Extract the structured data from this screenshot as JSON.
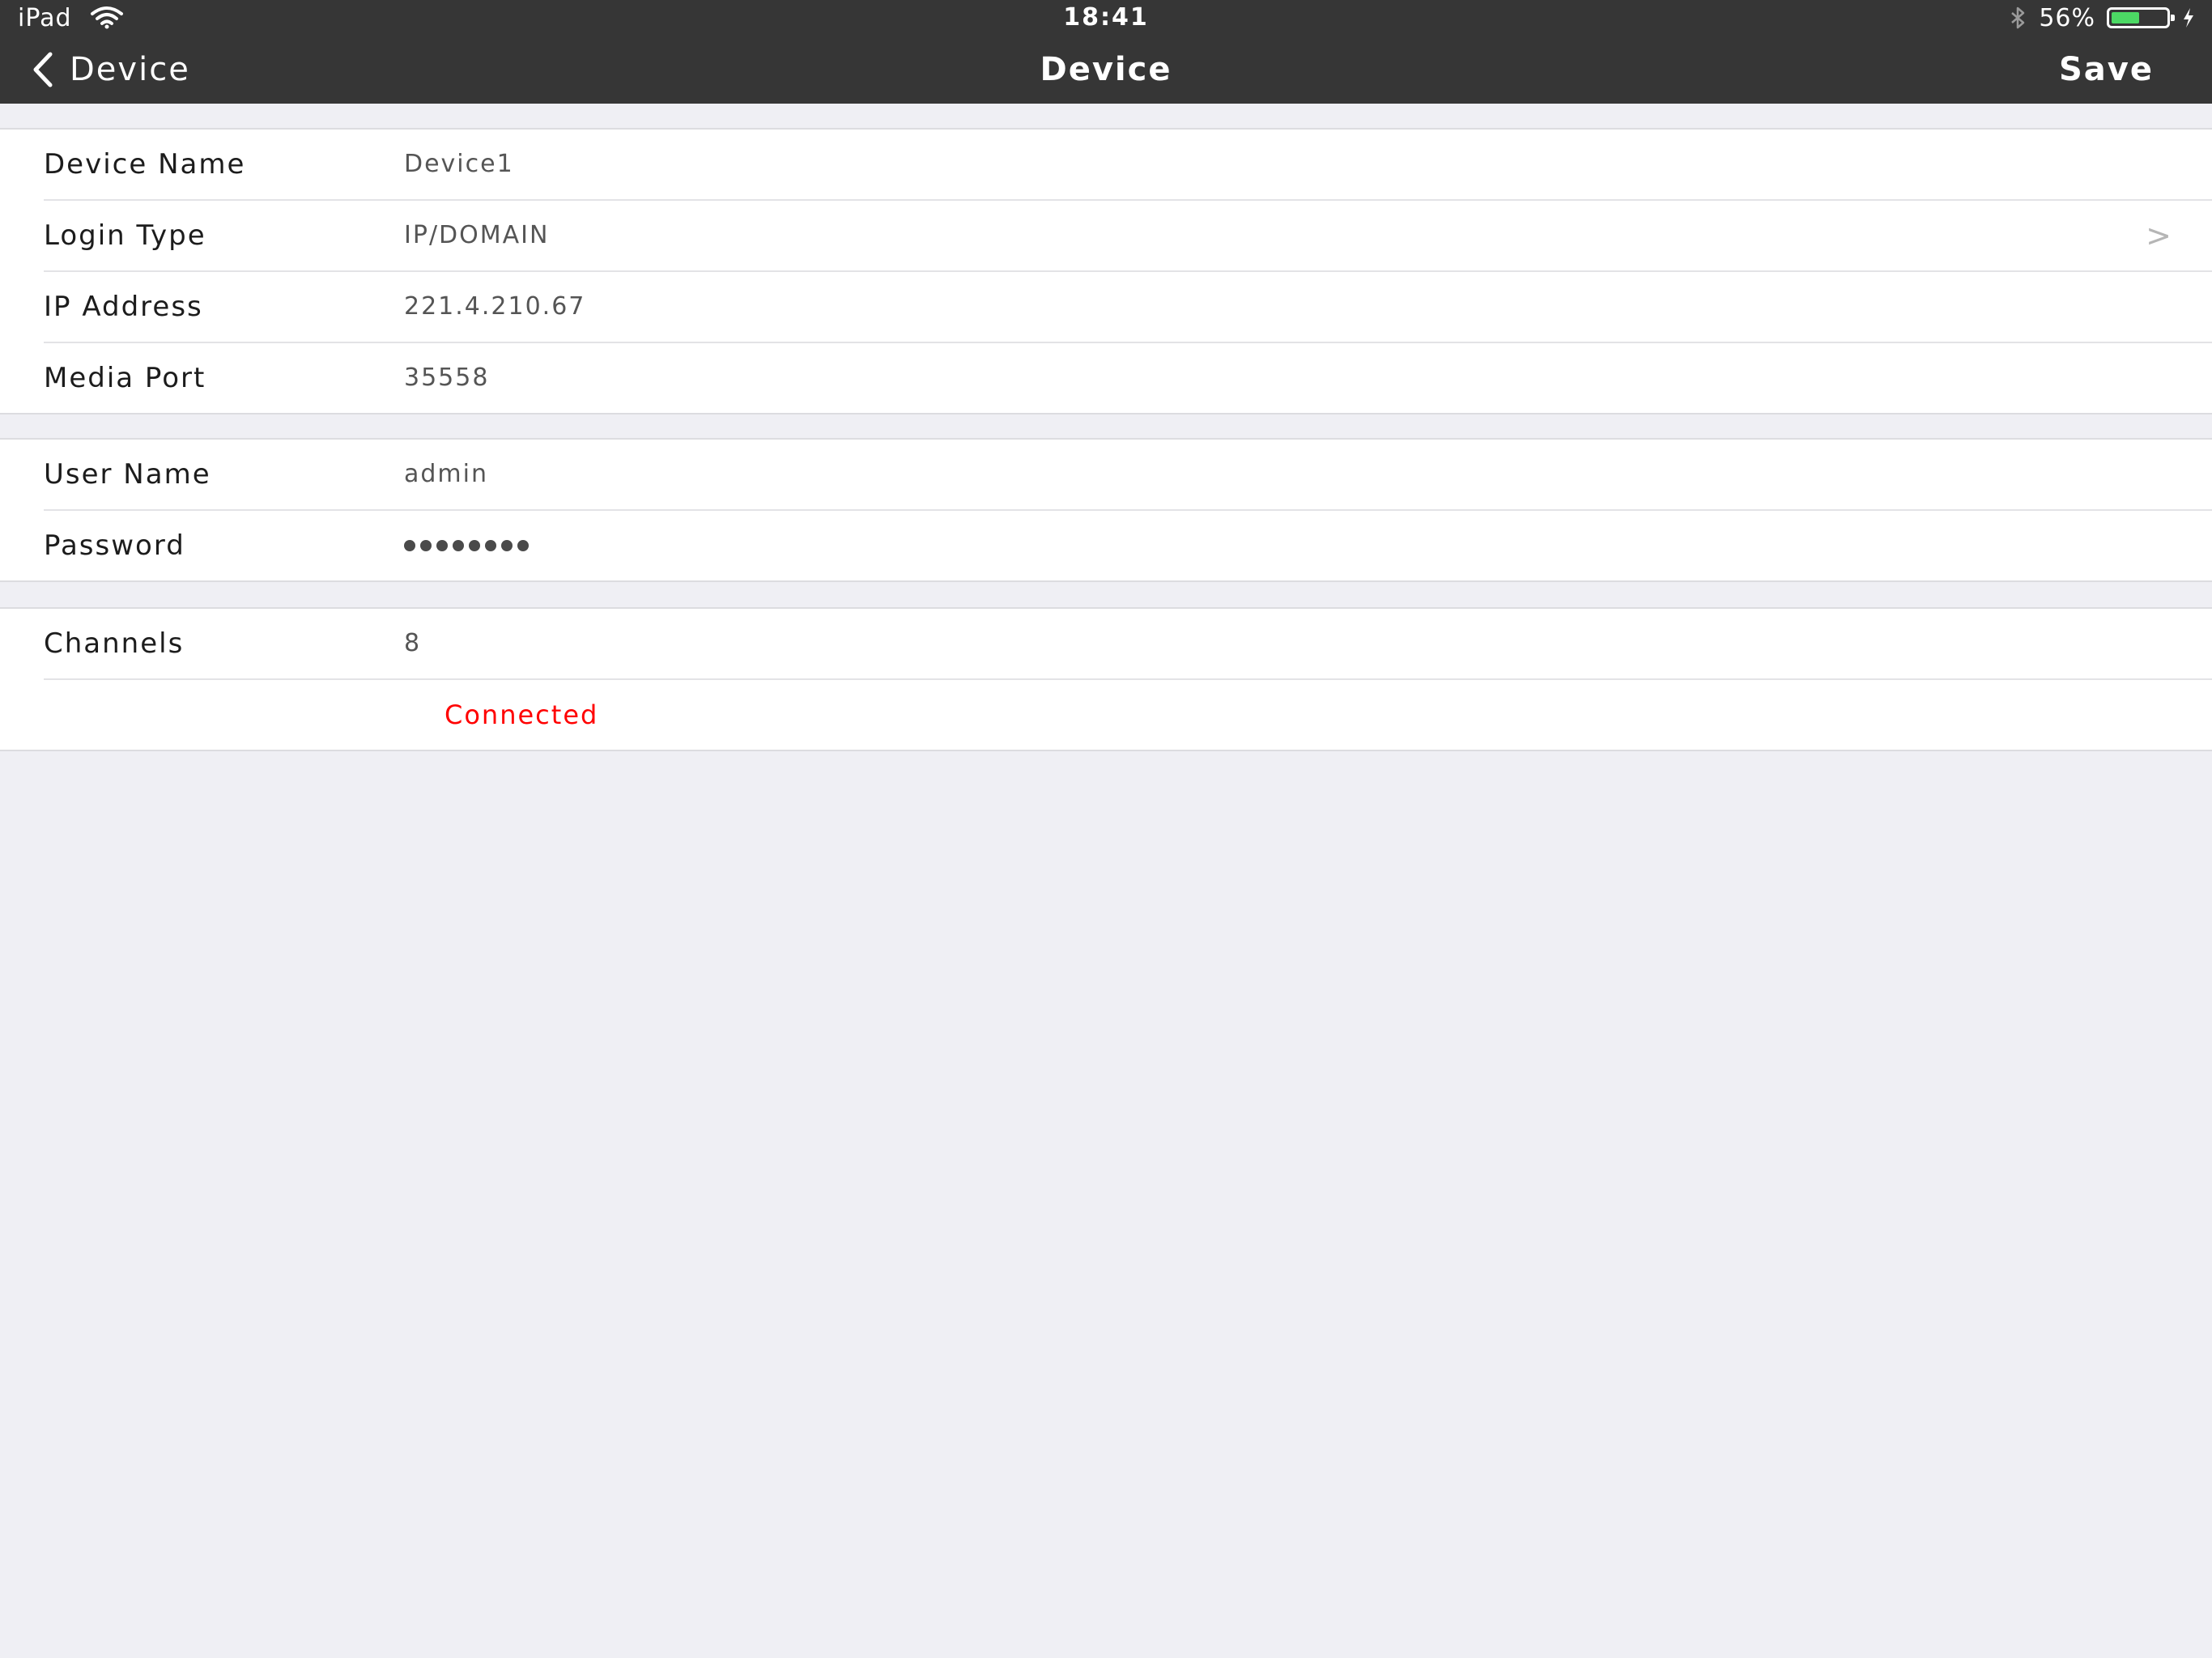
{
  "status_bar": {
    "device": "iPad",
    "time": "18:41",
    "battery_text": "56%",
    "battery_level": 0.56,
    "icons": [
      "wifi-icon",
      "bluetooth-icon",
      "battery-icon",
      "charging-icon"
    ]
  },
  "nav": {
    "back_label": "Device",
    "title": "Device",
    "save_label": "Save"
  },
  "section1": {
    "device_name": {
      "label": "Device Name",
      "value": "Device1"
    },
    "login_type": {
      "label": "Login Type",
      "value": "IP/DOMAIN",
      "chevron": ">"
    },
    "ip_address": {
      "label": "IP Address",
      "value": "221.4.210.67"
    },
    "media_port": {
      "label": "Media Port",
      "value": "35558"
    }
  },
  "section2": {
    "user_name": {
      "label": "User Name",
      "value": "admin"
    },
    "password": {
      "label": "Password",
      "masked_length": 8
    }
  },
  "section3": {
    "channels": {
      "label": "Channels",
      "value": "8"
    },
    "status": {
      "text": "Connected",
      "color": "#ff0000"
    }
  },
  "colors": {
    "nav_background": "#363636",
    "page_background": "#efeff4",
    "battery_fill": "#4cd964"
  }
}
